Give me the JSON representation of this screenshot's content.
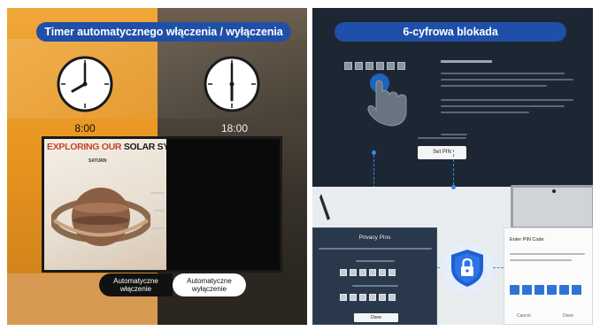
{
  "left_panel": {
    "title": "Timer automatycznego włączenia / wyłączenia",
    "clock_on": {
      "time": "8:00",
      "hour": 8,
      "minute": 0
    },
    "clock_off": {
      "time": "18:00",
      "hour": 6,
      "minute": 0
    },
    "tv_screen": {
      "headline_part1": "EXPLORING OUR ",
      "headline_part2": "SOLAR SYS",
      "subtitle": "SATURN"
    },
    "toggle": {
      "on_label": "Automatyczne włączenie",
      "off_label": "Automatyczne wyłączenie"
    },
    "colors": {
      "title_bg": "#1f4fa8",
      "orange": "#e8951f",
      "dark": "#2c2620"
    }
  },
  "right_panel": {
    "title": "6-cyfrowa blokada",
    "menu_heading": "1. Set up Protection 1%",
    "set_button": "Set PIN",
    "dark_popup": {
      "title": "Privacy Pins",
      "code_label_1": "Enter new PIN",
      "code_label_2": "Enter the PIN again",
      "button": "Done"
    },
    "light_popup": {
      "title": "Enter PIN Code",
      "cancel": "Cancel",
      "done": "Done"
    },
    "icons": [
      "hand-pointer-icon",
      "lock-shield-icon"
    ],
    "colors": {
      "accent": "#2d8cf0",
      "shield": "#1f5fd0",
      "panel_bg": "#1d2733"
    }
  }
}
